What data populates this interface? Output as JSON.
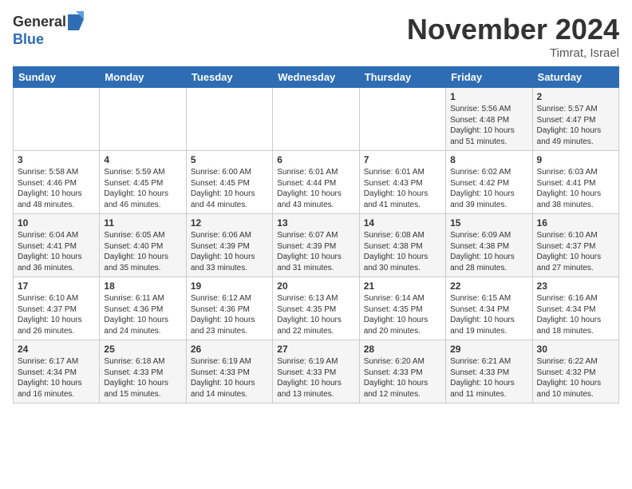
{
  "header": {
    "logo_general": "General",
    "logo_blue": "Blue",
    "title": "November 2024",
    "location": "Timrat, Israel"
  },
  "days_of_week": [
    "Sunday",
    "Monday",
    "Tuesday",
    "Wednesday",
    "Thursday",
    "Friday",
    "Saturday"
  ],
  "weeks": [
    [
      {
        "day": "",
        "info": ""
      },
      {
        "day": "",
        "info": ""
      },
      {
        "day": "",
        "info": ""
      },
      {
        "day": "",
        "info": ""
      },
      {
        "day": "",
        "info": ""
      },
      {
        "day": "1",
        "info": "Sunrise: 5:56 AM\nSunset: 4:48 PM\nDaylight: 10 hours and 51 minutes."
      },
      {
        "day": "2",
        "info": "Sunrise: 5:57 AM\nSunset: 4:47 PM\nDaylight: 10 hours and 49 minutes."
      }
    ],
    [
      {
        "day": "3",
        "info": "Sunrise: 5:58 AM\nSunset: 4:46 PM\nDaylight: 10 hours and 48 minutes."
      },
      {
        "day": "4",
        "info": "Sunrise: 5:59 AM\nSunset: 4:45 PM\nDaylight: 10 hours and 46 minutes."
      },
      {
        "day": "5",
        "info": "Sunrise: 6:00 AM\nSunset: 4:45 PM\nDaylight: 10 hours and 44 minutes."
      },
      {
        "day": "6",
        "info": "Sunrise: 6:01 AM\nSunset: 4:44 PM\nDaylight: 10 hours and 43 minutes."
      },
      {
        "day": "7",
        "info": "Sunrise: 6:01 AM\nSunset: 4:43 PM\nDaylight: 10 hours and 41 minutes."
      },
      {
        "day": "8",
        "info": "Sunrise: 6:02 AM\nSunset: 4:42 PM\nDaylight: 10 hours and 39 minutes."
      },
      {
        "day": "9",
        "info": "Sunrise: 6:03 AM\nSunset: 4:41 PM\nDaylight: 10 hours and 38 minutes."
      }
    ],
    [
      {
        "day": "10",
        "info": "Sunrise: 6:04 AM\nSunset: 4:41 PM\nDaylight: 10 hours and 36 minutes."
      },
      {
        "day": "11",
        "info": "Sunrise: 6:05 AM\nSunset: 4:40 PM\nDaylight: 10 hours and 35 minutes."
      },
      {
        "day": "12",
        "info": "Sunrise: 6:06 AM\nSunset: 4:39 PM\nDaylight: 10 hours and 33 minutes."
      },
      {
        "day": "13",
        "info": "Sunrise: 6:07 AM\nSunset: 4:39 PM\nDaylight: 10 hours and 31 minutes."
      },
      {
        "day": "14",
        "info": "Sunrise: 6:08 AM\nSunset: 4:38 PM\nDaylight: 10 hours and 30 minutes."
      },
      {
        "day": "15",
        "info": "Sunrise: 6:09 AM\nSunset: 4:38 PM\nDaylight: 10 hours and 28 minutes."
      },
      {
        "day": "16",
        "info": "Sunrise: 6:10 AM\nSunset: 4:37 PM\nDaylight: 10 hours and 27 minutes."
      }
    ],
    [
      {
        "day": "17",
        "info": "Sunrise: 6:10 AM\nSunset: 4:37 PM\nDaylight: 10 hours and 26 minutes."
      },
      {
        "day": "18",
        "info": "Sunrise: 6:11 AM\nSunset: 4:36 PM\nDaylight: 10 hours and 24 minutes."
      },
      {
        "day": "19",
        "info": "Sunrise: 6:12 AM\nSunset: 4:36 PM\nDaylight: 10 hours and 23 minutes."
      },
      {
        "day": "20",
        "info": "Sunrise: 6:13 AM\nSunset: 4:35 PM\nDaylight: 10 hours and 22 minutes."
      },
      {
        "day": "21",
        "info": "Sunrise: 6:14 AM\nSunset: 4:35 PM\nDaylight: 10 hours and 20 minutes."
      },
      {
        "day": "22",
        "info": "Sunrise: 6:15 AM\nSunset: 4:34 PM\nDaylight: 10 hours and 19 minutes."
      },
      {
        "day": "23",
        "info": "Sunrise: 6:16 AM\nSunset: 4:34 PM\nDaylight: 10 hours and 18 minutes."
      }
    ],
    [
      {
        "day": "24",
        "info": "Sunrise: 6:17 AM\nSunset: 4:34 PM\nDaylight: 10 hours and 16 minutes."
      },
      {
        "day": "25",
        "info": "Sunrise: 6:18 AM\nSunset: 4:33 PM\nDaylight: 10 hours and 15 minutes."
      },
      {
        "day": "26",
        "info": "Sunrise: 6:19 AM\nSunset: 4:33 PM\nDaylight: 10 hours and 14 minutes."
      },
      {
        "day": "27",
        "info": "Sunrise: 6:19 AM\nSunset: 4:33 PM\nDaylight: 10 hours and 13 minutes."
      },
      {
        "day": "28",
        "info": "Sunrise: 6:20 AM\nSunset: 4:33 PM\nDaylight: 10 hours and 12 minutes."
      },
      {
        "day": "29",
        "info": "Sunrise: 6:21 AM\nSunset: 4:33 PM\nDaylight: 10 hours and 11 minutes."
      },
      {
        "day": "30",
        "info": "Sunrise: 6:22 AM\nSunset: 4:32 PM\nDaylight: 10 hours and 10 minutes."
      }
    ]
  ]
}
